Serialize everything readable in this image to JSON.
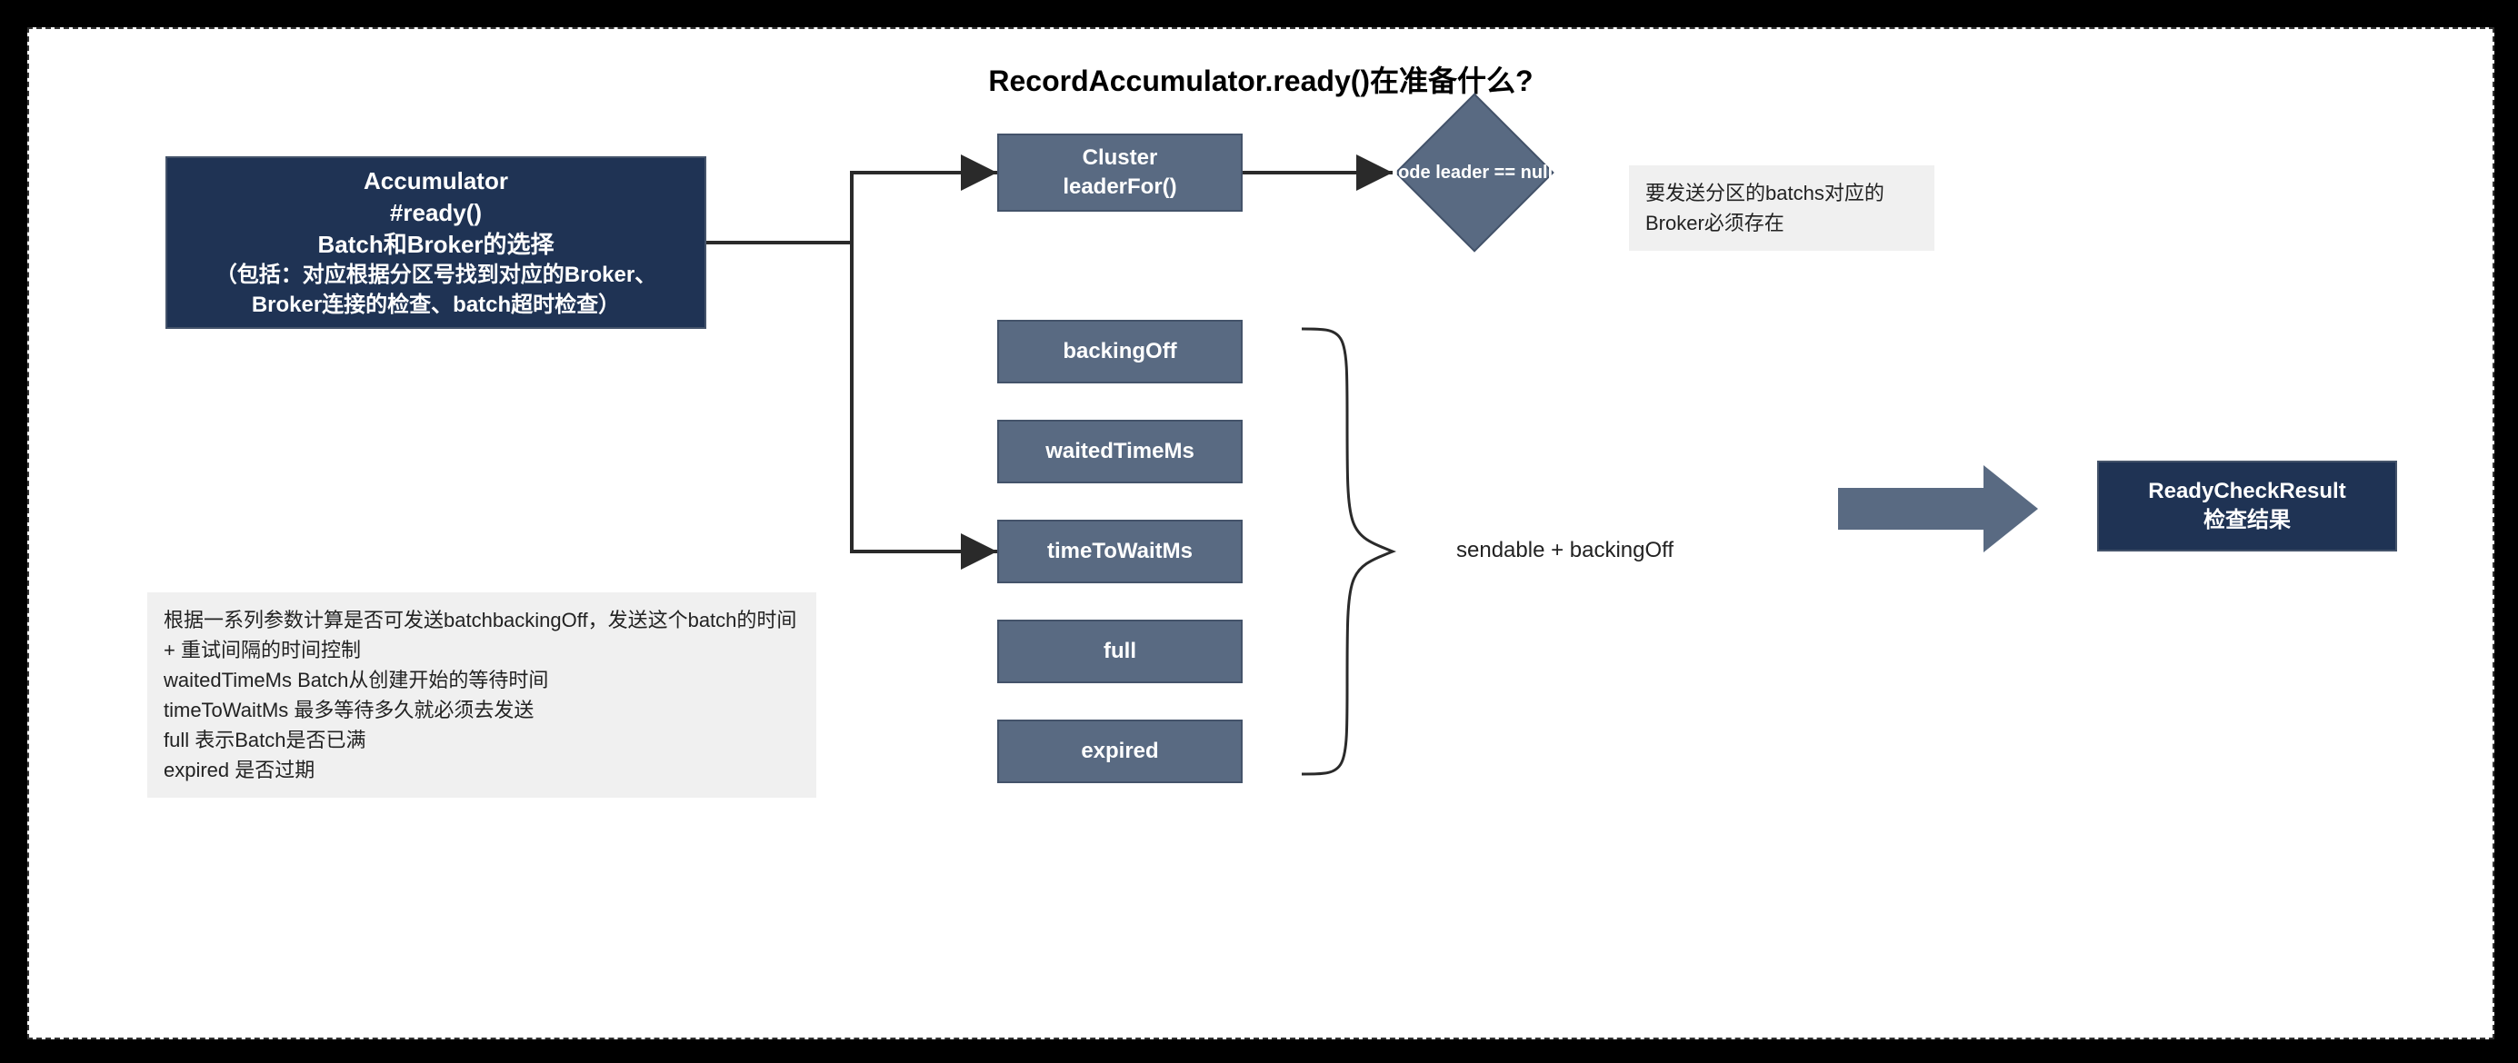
{
  "title": "RecordAccumulator.ready()在准备什么?",
  "accumulator": {
    "line1": "Accumulator",
    "line2": "#ready()",
    "line3": "Batch和Broker的选择",
    "line4": "（包括：对应根据分区号找到对应的Broker、Broker连接的检查、batch超时检查）"
  },
  "cluster": {
    "line1": "Cluster",
    "line2": "leaderFor()"
  },
  "diamond": "Node leader == null?",
  "leader_note": "要发送分区的batchs对应的Broker必须存在",
  "conds": {
    "c1": "backingOff",
    "c2": "waitedTimeMs",
    "c3": "timeToWaitMs",
    "c4": "full",
    "c5": "expired"
  },
  "cond_expr": "sendable + backingOff",
  "params_note": "根据一系列参数计算是否可发送batchbackingOff，发送这个batch的时间 + 重试间隔的时间控制\nwaitedTimeMs Batch从创建开始的等待时间\ntimeToWaitMs 最多等待多久就必须去发送\nfull 表示Batch是否已满\nexpired 是否过期",
  "result": {
    "line1": "ReadyCheckResult",
    "line2": "检查结果"
  }
}
